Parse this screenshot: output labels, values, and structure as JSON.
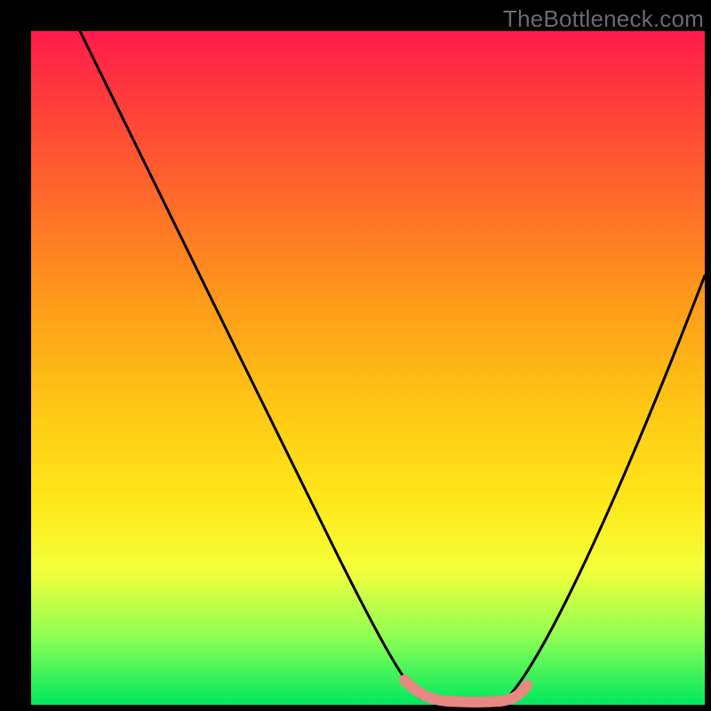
{
  "watermark": "TheBottleneck.com",
  "colors": {
    "gradient_top": "#ff1a4d",
    "gradient_mid": "#ffe81a",
    "gradient_bottom": "#00e85f",
    "curve": "#000000",
    "highlight": "#e98782",
    "frame": "#000000"
  },
  "chart_data": {
    "type": "line",
    "title": "",
    "xlabel": "",
    "ylabel": "",
    "xlim": [
      0,
      100
    ],
    "ylim": [
      0,
      100
    ],
    "grid": false,
    "legend": false,
    "series": [
      {
        "name": "left-branch",
        "x": [
          8,
          15,
          22,
          29,
          36,
          43,
          50,
          55,
          58
        ],
        "values": [
          100,
          85,
          70,
          55,
          40,
          26,
          12,
          3,
          0
        ]
      },
      {
        "name": "valley-floor",
        "x": [
          58,
          62,
          66,
          70
        ],
        "values": [
          0,
          0,
          0,
          0
        ]
      },
      {
        "name": "right-branch",
        "x": [
          70,
          76,
          82,
          88,
          94,
          100
        ],
        "values": [
          0,
          10,
          22,
          36,
          51,
          65
        ]
      },
      {
        "name": "highlighted-segment",
        "x": [
          55,
          58,
          62,
          66,
          70,
          72
        ],
        "values": [
          3,
          0,
          0,
          0,
          0,
          2
        ]
      }
    ],
    "notes": "Left branch descends from top-left with gentle convex curvature to a flat valley near x≈58–70 at y≈0, then the right branch rises roughly linearly to about y≈65 at x=100. A short thicker pink segment highlights the bottom of the valley. Values estimated from pixel positions; no numeric axes or ticks are shown in the image."
  }
}
